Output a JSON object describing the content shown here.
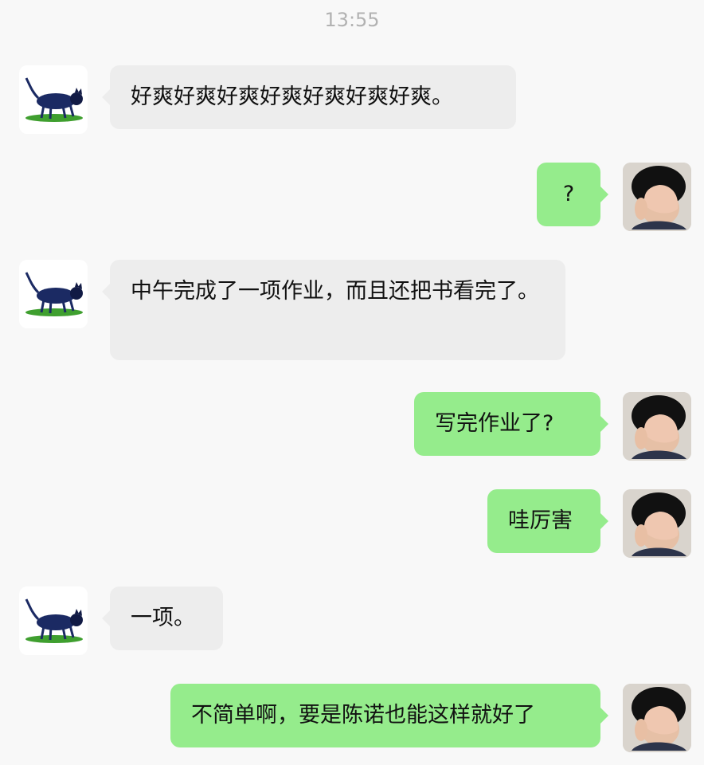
{
  "timestamp": "13:55",
  "colors": {
    "background": "#f8f8f8",
    "incoming_bubble": "#ededed",
    "outgoing_bubble": "#95ec8c",
    "timestamp_text": "#b2b2b2"
  },
  "contacts": {
    "other": {
      "avatar_icon": "black-cat-icon"
    },
    "self": {
      "avatar_icon": "child-covering-face-photo"
    }
  },
  "messages": [
    {
      "from": "other",
      "text": "好爽好爽好爽好爽好爽好爽好爽。"
    },
    {
      "from": "self",
      "text": "?"
    },
    {
      "from": "other",
      "text": "中午完成了一项作业，而且还把书看完了。"
    },
    {
      "from": "self",
      "text": "写完作业了?"
    },
    {
      "from": "self",
      "text": "哇厉害"
    },
    {
      "from": "other",
      "text": "一项。"
    },
    {
      "from": "self",
      "text": "不简单啊，要是陈诺也能这样就好了"
    }
  ]
}
